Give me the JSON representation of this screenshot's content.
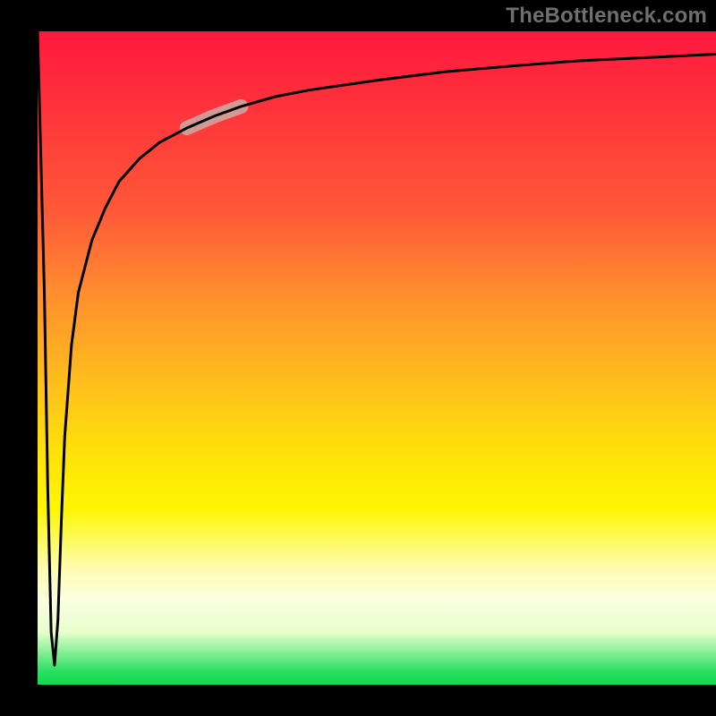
{
  "watermark": "TheBottleneck.com",
  "chart_data": {
    "type": "line",
    "title": "",
    "xlabel": "",
    "ylabel": "",
    "xlim": [
      0,
      100
    ],
    "ylim": [
      0,
      100
    ],
    "grid": false,
    "legend": false,
    "series": [
      {
        "name": "bottleneck-curve",
        "x": [
          0,
          1,
          1.5,
          2,
          2.5,
          3,
          3.5,
          4,
          5,
          6,
          8,
          10,
          12,
          15,
          18,
          22,
          26,
          30,
          35,
          40,
          50,
          60,
          70,
          80,
          90,
          100
        ],
        "y": [
          100,
          60,
          30,
          8,
          3,
          10,
          25,
          38,
          52,
          60,
          68,
          73,
          77,
          80.5,
          83,
          85.2,
          87,
          88.5,
          90,
          91,
          92.5,
          93.8,
          94.7,
          95.5,
          96,
          96.5
        ]
      }
    ],
    "highlight_segment": {
      "series": "bottleneck-curve",
      "x_start": 22,
      "x_end": 30,
      "color": "#d29a95"
    },
    "colors": {
      "curve": "#000000",
      "highlight": "#d29a95",
      "gradient_top": "#ff1a3e",
      "gradient_bottom": "#12d850"
    }
  }
}
